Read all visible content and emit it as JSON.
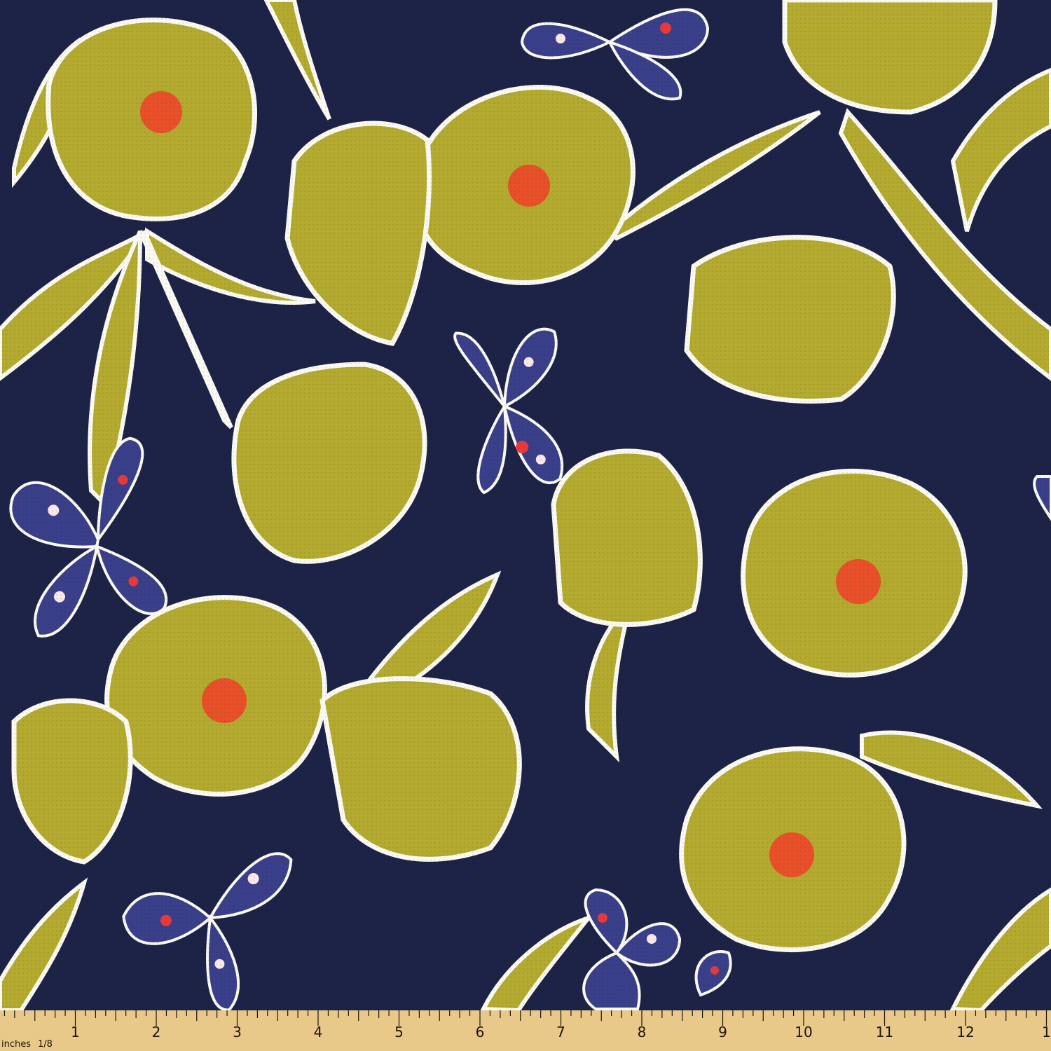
{
  "fabric": {
    "background_color": "#1d2347",
    "flower_color": "#b3aa2f",
    "outline_color": "#fbfaf2",
    "center_color": "#e8502a",
    "butterfly_wing_color": "#3a3f8a",
    "butterfly_accent_color": "#e83a3a",
    "butterfly_spot_color": "#fbe8e8"
  },
  "ruler": {
    "color": "#e9c98a",
    "unit_label": "inches",
    "fraction_label": "1/8",
    "numbers": [
      "1",
      "2",
      "3",
      "4",
      "5",
      "6",
      "7",
      "8",
      "9",
      "10",
      "11",
      "12",
      "1"
    ]
  }
}
